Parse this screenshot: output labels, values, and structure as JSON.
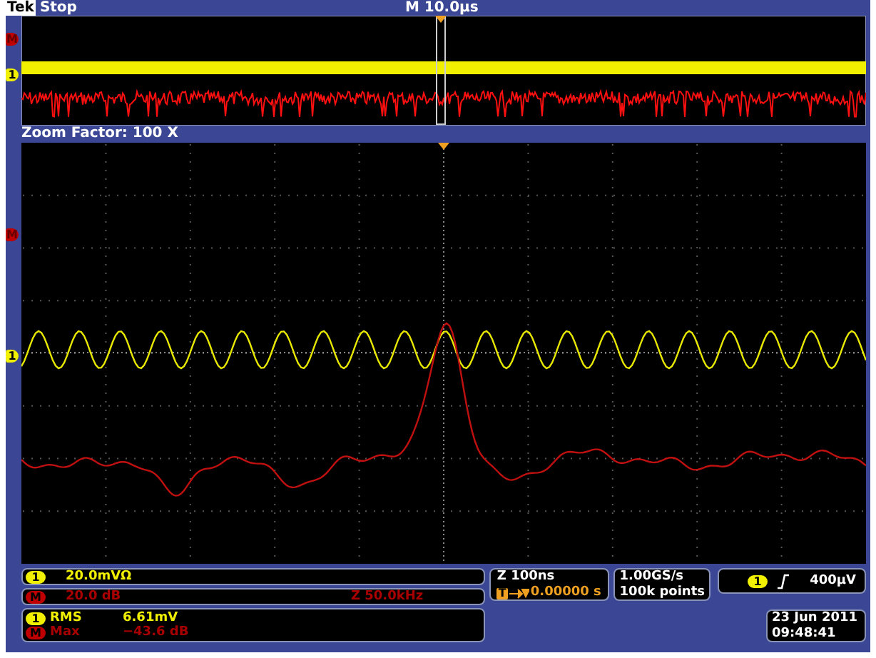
{
  "header": {
    "brand": "Tek",
    "status": "Stop",
    "timebase": "M 10.0µs"
  },
  "overview": {
    "markers": [
      {
        "label": "M",
        "color": "#c00000",
        "kind": "math"
      },
      {
        "label": "1",
        "color": "#f0f000",
        "kind": "channel"
      }
    ]
  },
  "zoom_label": "Zoom Factor: 100 X",
  "main": {
    "markers": [
      {
        "label": "M",
        "color": "#c00000",
        "kind": "math"
      },
      {
        "label": "1",
        "color": "#f0f000",
        "kind": "channel"
      }
    ]
  },
  "channel_readouts": [
    {
      "badge": "1",
      "color": "#f0f000",
      "kind": "channel",
      "scale": "20.0mVΩ"
    },
    {
      "badge": "M",
      "color": "#c00000",
      "kind": "math",
      "scale": "20.0 dB",
      "extra": "Z 50.0kHz"
    }
  ],
  "measurements": [
    {
      "badge": "1",
      "color": "#f0f000",
      "kind": "channel",
      "name": "RMS",
      "value": "6.61mV"
    },
    {
      "badge": "M",
      "color": "#c00000",
      "kind": "math",
      "name": "Max",
      "value": "−43.6 dB"
    }
  ],
  "zoom_readout": {
    "scale": "Z 100ns",
    "trigger_badge": "T",
    "position": "0.00000 s"
  },
  "acquisition": {
    "rate": "1.00GS/s",
    "length": "100k points"
  },
  "trigger": {
    "badge": "1",
    "color": "#f0f000",
    "level": "400µV"
  },
  "timestamp": {
    "date": "23 Jun 2011",
    "time": "09:48:41"
  }
}
